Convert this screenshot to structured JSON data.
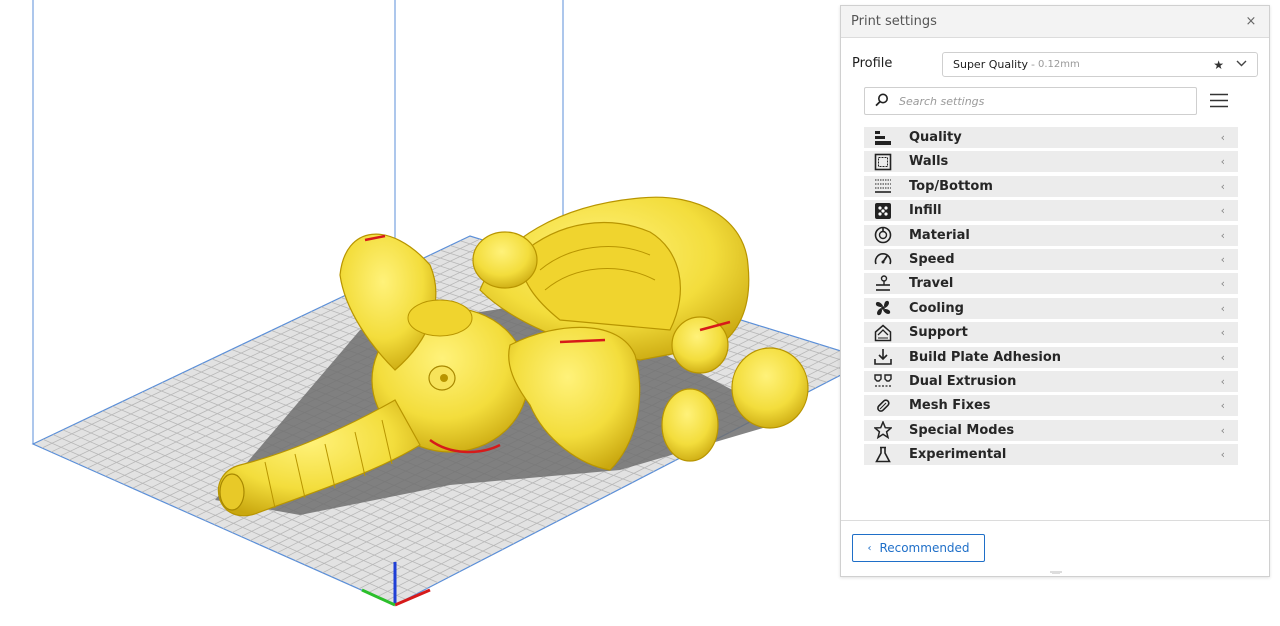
{
  "viewport": {
    "colors": {
      "model": "#f3dd3c",
      "model_shade": "#c9a70f",
      "overhang": "#d61a1a",
      "plate_line": "#5b8fd8"
    }
  },
  "panel": {
    "title": "Print settings",
    "close_icon": "×",
    "profile": {
      "label": "Profile",
      "name": "Super Quality",
      "separator": "-",
      "layer_height": "0.12mm",
      "favorite_icon": "★",
      "dropdown_icon": "⌄"
    },
    "search": {
      "placeholder": "Search settings"
    },
    "categories": [
      {
        "label": "Quality",
        "icon": "quality-icon"
      },
      {
        "label": "Walls",
        "icon": "walls-icon"
      },
      {
        "label": "Top/Bottom",
        "icon": "top-bottom-icon"
      },
      {
        "label": "Infill",
        "icon": "infill-icon"
      },
      {
        "label": "Material",
        "icon": "material-icon"
      },
      {
        "label": "Speed",
        "icon": "speed-icon"
      },
      {
        "label": "Travel",
        "icon": "travel-icon"
      },
      {
        "label": "Cooling",
        "icon": "cooling-icon"
      },
      {
        "label": "Support",
        "icon": "support-icon"
      },
      {
        "label": "Build Plate Adhesion",
        "icon": "build-plate-adhesion-icon"
      },
      {
        "label": "Dual Extrusion",
        "icon": "dual-extrusion-icon"
      },
      {
        "label": "Mesh Fixes",
        "icon": "mesh-fixes-icon"
      },
      {
        "label": "Special Modes",
        "icon": "special-modes-icon"
      },
      {
        "label": "Experimental",
        "icon": "experimental-icon"
      }
    ],
    "category_arrow": "‹",
    "footer": {
      "recommended_label": "Recommended",
      "recommended_arrow": "‹"
    }
  }
}
